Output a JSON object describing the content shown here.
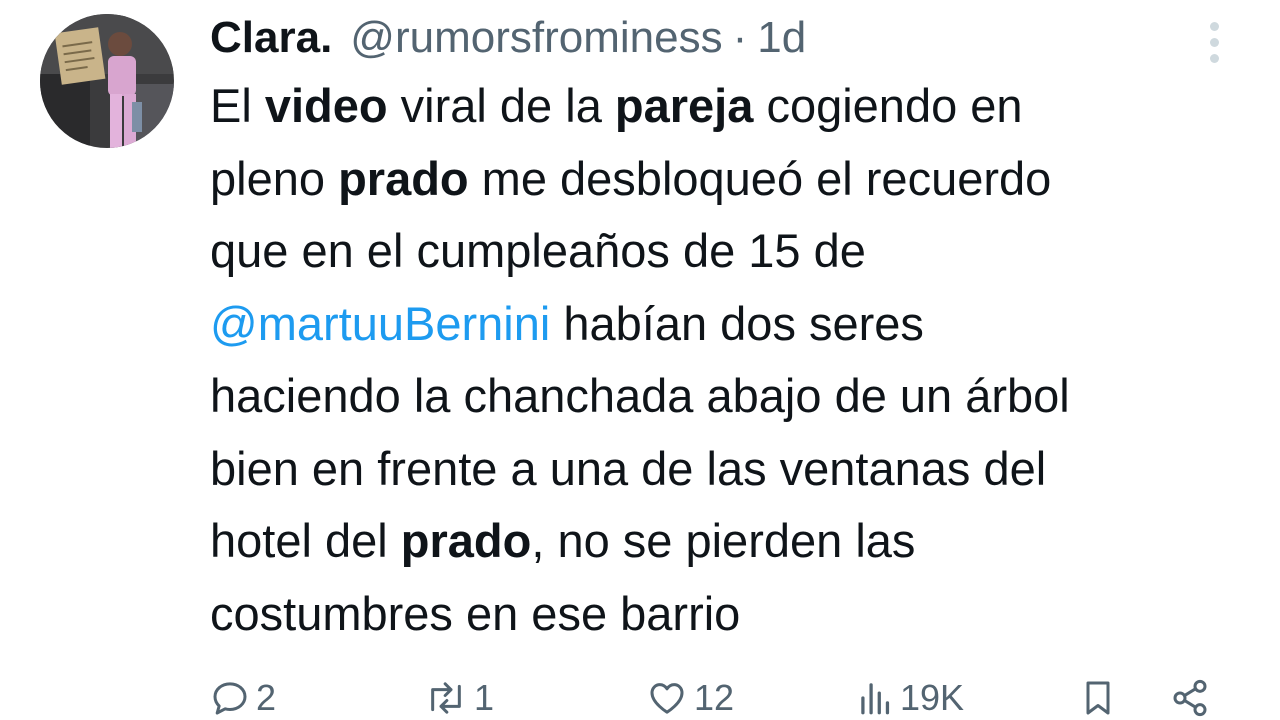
{
  "tweet": {
    "author": {
      "display_name": "Clara.",
      "handle": "@rumorsfrominess",
      "separator": "·",
      "time": "1d"
    },
    "text": {
      "lines": [
        [
          {
            "t": "El ",
            "b": false
          },
          {
            "t": "video",
            "b": true
          },
          {
            "t": " viral de la ",
            "b": false
          },
          {
            "t": "pareja",
            "b": true
          },
          {
            "t": " cogiendo en",
            "b": false
          }
        ],
        [
          {
            "t": "pleno ",
            "b": false
          },
          {
            "t": "prado",
            "b": true
          },
          {
            "t": " me desbloqueó el recuerdo",
            "b": false
          }
        ],
        [
          {
            "t": "que en el cumpleaños de 15 de",
            "b": false
          }
        ],
        [
          {
            "t": "@martuuBernini",
            "m": true
          },
          {
            "t": " habían dos seres",
            "b": false
          }
        ],
        [
          {
            "t": "haciendo la chanchada abajo de un árbol",
            "b": false
          }
        ],
        [
          {
            "t": "bien en frente a una de las ventanas del",
            "b": false
          }
        ],
        [
          {
            "t": "hotel del ",
            "b": false
          },
          {
            "t": "prado",
            "b": true
          },
          {
            "t": ", no se pierden las",
            "b": false
          }
        ],
        [
          {
            "t": "costumbres en ese barrio",
            "b": false
          }
        ]
      ]
    },
    "stats": {
      "replies": "2",
      "retweets": "1",
      "likes": "12",
      "views": "19K"
    },
    "icons": {
      "more": "more-dots-icon",
      "reply": "reply-icon",
      "retweet": "retweet-icon",
      "like": "heart-icon",
      "views": "views-chart-icon",
      "bookmark": "bookmark-icon",
      "share": "share-icon"
    },
    "colors": {
      "text": "#0f1419",
      "secondary": "#536471",
      "link": "#1d9bf0",
      "background": "#ffffff"
    }
  }
}
